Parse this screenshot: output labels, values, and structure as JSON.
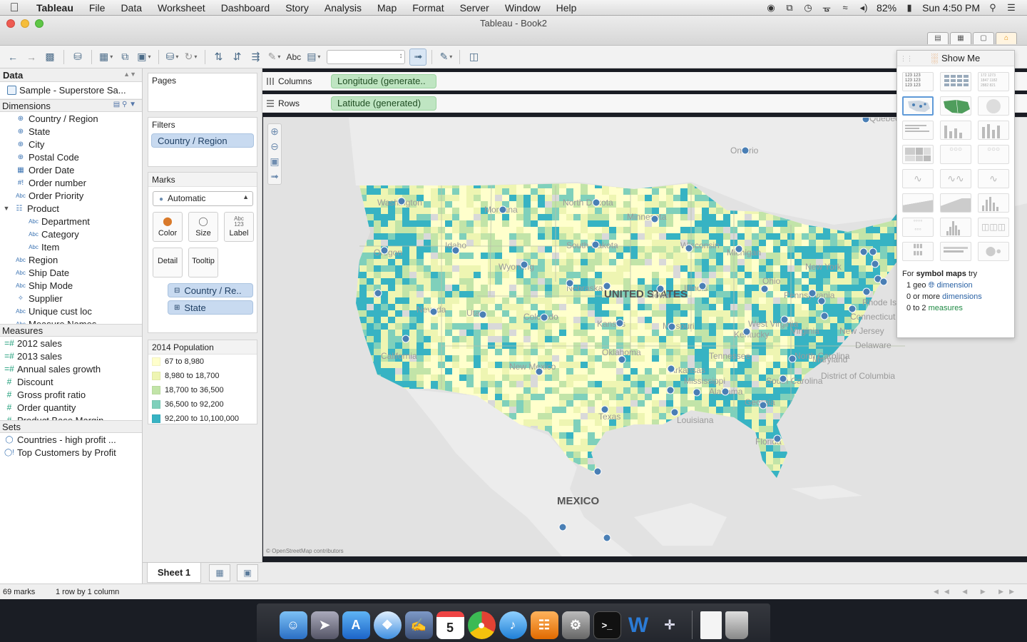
{
  "menubar": {
    "app": "Tableau",
    "items": [
      "File",
      "Data",
      "Worksheet",
      "Dashboard",
      "Story",
      "Analysis",
      "Map",
      "Format",
      "Server",
      "Window",
      "Help"
    ],
    "battery": "82%",
    "clock": "Sun 4:50 PM"
  },
  "window": {
    "title": "Tableau - Book2"
  },
  "data_pane": {
    "header": "Data",
    "datasource": "Sample - Superstore Sa...",
    "dimensions_header": "Dimensions",
    "dimensions": [
      {
        "name": "Country / Region",
        "icon": "globe-icon",
        "level": 1
      },
      {
        "name": "State",
        "icon": "globe-icon",
        "level": 1
      },
      {
        "name": "City",
        "icon": "globe-icon",
        "level": 1
      },
      {
        "name": "Postal Code",
        "icon": "globe-icon",
        "level": 1
      },
      {
        "name": "Order Date",
        "icon": "calendar-icon",
        "level": 0
      },
      {
        "name": "Order number",
        "icon": "number-icon",
        "level": 0
      },
      {
        "name": "Order Priority",
        "icon": "abc-icon",
        "level": 0
      },
      {
        "name": "Product",
        "icon": "hierarchy-icon",
        "level": 0
      },
      {
        "name": "Department",
        "icon": "abc-icon",
        "level": 2
      },
      {
        "name": "Category",
        "icon": "abc-icon",
        "level": 2
      },
      {
        "name": "Item",
        "icon": "abc-icon",
        "level": 2
      },
      {
        "name": "Region",
        "icon": "abc-icon",
        "level": 0
      },
      {
        "name": "Ship Date",
        "icon": "abc-icon",
        "level": 0
      },
      {
        "name": "Ship Mode",
        "icon": "abc-icon",
        "level": 0
      },
      {
        "name": "Supplier",
        "icon": "link-icon",
        "level": 0
      },
      {
        "name": "Unique cust loc",
        "icon": "abc-icon",
        "level": 0
      },
      {
        "name": "Measure Names",
        "icon": "abc-icon",
        "level": 0
      }
    ],
    "measures_header": "Measures",
    "measures": [
      "2012 sales",
      "2013 sales",
      "Annual sales growth",
      "Discount",
      "Gross profit ratio",
      "Order quantity",
      "Product Base Margin"
    ],
    "sets_header": "Sets",
    "sets": [
      "Countries - high profit ...",
      "Top Customers by Profit"
    ]
  },
  "shelves": {
    "pages_label": "Pages",
    "filters_label": "Filters",
    "filter_pill": "Country / Region",
    "marks_label": "Marks",
    "mark_type": "Automatic",
    "mark_buttons": [
      "Color",
      "Size",
      "Label",
      "Detail",
      "Tooltip"
    ],
    "detail_pills": [
      "Country / Re..",
      "State"
    ],
    "columns_label": "Columns",
    "columns_pill": "Longitude (generate..",
    "rows_label": "Rows",
    "rows_pill": "Latitude (generated)"
  },
  "legend": {
    "title": "2014 Population",
    "items": [
      {
        "label": "67 to 8,980",
        "color": "#ffffcc"
      },
      {
        "label": "8,980 to 18,700",
        "color": "#eef5b2"
      },
      {
        "label": "18,700 to 36,500",
        "color": "#c2e4a8"
      },
      {
        "label": "36,500 to 92,200",
        "color": "#7fd0bb"
      },
      {
        "label": "92,200 to 10,100,000",
        "color": "#37b3c3"
      }
    ]
  },
  "map": {
    "labels": [
      "Quebec",
      "Ontario",
      "Washington",
      "Montana",
      "North Dakota",
      "Minnesota",
      "Oregon",
      "Idaho",
      "South Dakota",
      "Wisconsin",
      "Michigan",
      "New York",
      "Wyoming",
      "UNITED STATES",
      "Nebraska",
      "Iowa",
      "Illinois",
      "Ohio",
      "Pennsylvania",
      "Nevada",
      "Utah",
      "Colorado",
      "Kansas",
      "Missouri",
      "Kentucky",
      "West Virginia",
      "Virginia",
      "California",
      "Oklahoma",
      "Tennessee",
      "North Carolina",
      "New Mexico",
      "Arkansas",
      "South Carolina",
      "Mississippi",
      "Alabama",
      "Georgia",
      "Texas",
      "Louisiana",
      "Florida",
      "MEXICO",
      "Rhode Island",
      "Connecticut",
      "New Jersey",
      "Delaware",
      "Maryland",
      "District of Columbia"
    ],
    "attribution": "© OpenStreetMap contributors",
    "point_color": "#4a7fb5"
  },
  "show_me": {
    "title": "Show Me",
    "hint_intro": "For",
    "hint_bold": "symbol maps",
    "hint_try": "try",
    "req1_a": "1 geo",
    "req1_b": "dimension",
    "req2_a": "0 or more",
    "req2_b": "dimensions",
    "req3_a": "0 to 2",
    "req3_b": "measures"
  },
  "sheet_tabs": {
    "active": "Sheet 1"
  },
  "status": {
    "marks": "69 marks",
    "layout": "1 row by 1 column"
  }
}
